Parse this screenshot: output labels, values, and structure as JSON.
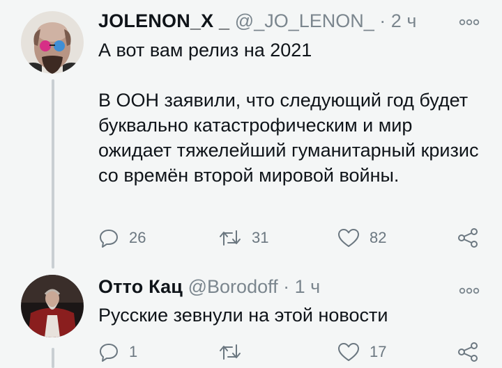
{
  "tweets": [
    {
      "display_name": "JOLENON_X _",
      "handle": "@_JO_LENON_",
      "separator": "·",
      "time": "2 ч",
      "text": "А вот вам релиз на 2021\n\nВ ООН заявили, что следующий год будет буквально катастрофическим и мир ожидает тяжелейший гуманитарный кризис со времён второй мировой войны.",
      "replies": "26",
      "retweets": "31",
      "likes": "82",
      "more_icon": "more-icon",
      "colors": {
        "text": "#0f1419",
        "secondary": "#6b7780",
        "background": "#f4f6f6"
      }
    },
    {
      "display_name": "Отто Кац",
      "handle": "@Borodoff",
      "separator": "·",
      "time": "1 ч",
      "text": "Русские зевнули на этой новости",
      "replies": "1",
      "retweets": "",
      "likes": "17",
      "more_icon": "more-icon"
    }
  ]
}
